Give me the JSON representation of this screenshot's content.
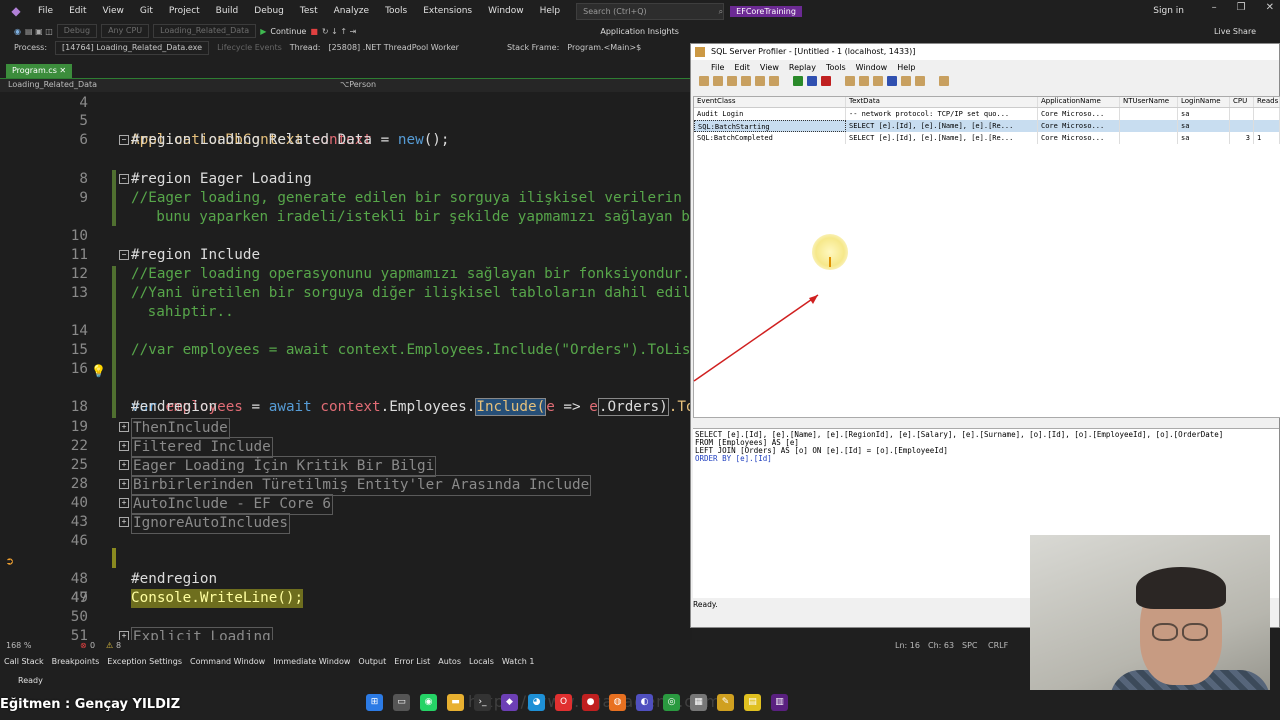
{
  "vs": {
    "menu": [
      "File",
      "Edit",
      "View",
      "Git",
      "Project",
      "Build",
      "Debug",
      "Test",
      "Analyze",
      "Tools",
      "Extensions",
      "Window",
      "Help"
    ],
    "search_placeholder": "Search (Ctrl+Q)",
    "solution_name": "EFCoreTraining",
    "signin": "Sign in",
    "toolbar_debug_config": "Debug",
    "toolbar_platform": "Any CPU",
    "toolbar_project": "Loading_Related_Data",
    "continue_label": "Continue",
    "app_insights": "Application Insights",
    "live_share": "Live Share",
    "process_label": "Process:",
    "process_value": "[14764] Loading_Related_Data.exe",
    "lifecycle_label": "Lifecycle Events",
    "thread_label": "Thread:",
    "thread_value": "[25808] .NET ThreadPool Worker",
    "stackframe_label": "Stack Frame:",
    "stackframe_value": "Program.<Main>$",
    "tab_file": "Program.cs",
    "nav_project": "Loading_Related_Data",
    "nav_type": "Person",
    "zoom": "168 %",
    "errors": "0",
    "warnings": "8",
    "cursor_ln": "Ln: 16",
    "cursor_ch": "Ch: 63",
    "spc": "SPC",
    "crlf": "CRLF",
    "bottom_tabs": [
      "Call Stack",
      "Breakpoints",
      "Exception Settings",
      "Command Window",
      "Immediate Window",
      "Output",
      "Error List",
      "Autos",
      "Locals",
      "Watch 1"
    ],
    "status_ready": "Ready"
  },
  "code": {
    "l4": "4",
    "l5n": "5",
    "l5": [
      "ApplicationDbContext",
      " ",
      "context",
      " = ",
      "new",
      "();"
    ],
    "l6n": "6",
    "l6": "#region Loading Related Data",
    "l8n": "8",
    "l8": "#region Eager Loading",
    "l9n": "9",
    "l9a": "//Eager loading, generate edilen bir sorguya ilişkisel verilerin p",
    "l9b": "  bunu yaparken iradeli/istekli bir şekilde yapmamızı sağlayan bi",
    "l10n": "10",
    "l11n": "11",
    "l11": "#region Include",
    "l12n": "12",
    "l12": "//Eager loading operasyonunu yapmamızı sağlayan bir fonksiyondur.",
    "l13n": "13",
    "l13a": "//Yani üretilen bir sorguya diğer ilişkisel tabloların dahil edilm",
    "l13b": " sahiptir..",
    "l15n": "15",
    "l15": "//var employees = await context.Employees.Include(\"Orders\").ToList",
    "l16n": "16",
    "l16": [
      "var",
      " ",
      "employees",
      " = ",
      "await",
      " ",
      "context",
      ".Employees.",
      "Include(",
      "e",
      " => ",
      "e",
      ".Orders)",
      ".To"
    ],
    "l18n": "18",
    "l18": "#endregion",
    "collapsed": [
      {
        "n": "19",
        "t": "ThenInclude"
      },
      {
        "n": "22",
        "t": "Filtered Include"
      },
      {
        "n": "25",
        "t": "Eager Loading İçin Kritik Bir Bilgi"
      },
      {
        "n": "28",
        "t": "Birbirlerinden Türetilmiş Entity'ler Arasında Include"
      },
      {
        "n": "40",
        "t": "AutoInclude - EF Core 6"
      },
      {
        "n": "43",
        "t": "IgnoreAutoIncludes"
      }
    ],
    "l46n": "46",
    "l47n": "47",
    "l47": "Console.WriteLine();",
    "l48n": "48",
    "l48": "#endregion",
    "l49n": "49",
    "l50n": "50",
    "l51n": "51",
    "l51": "Explicit Loading"
  },
  "profiler": {
    "title": "SQL Server Profiler - [Untitled - 1 (localhost, 1433)]",
    "menu": [
      "File",
      "Edit",
      "View",
      "Replay",
      "Tools",
      "Window",
      "Help"
    ],
    "columns": [
      "EventClass",
      "TextData",
      "ApplicationName",
      "NTUserName",
      "LoginName",
      "CPU",
      "Reads"
    ],
    "rows": [
      [
        "Audit Login",
        "-- network protocol: TCP/IP  set quo...",
        "Core Microso...",
        "",
        "sa",
        "",
        ""
      ],
      [
        "SQL:BatchStarting",
        "SELECT [e].[Id], [e].[Name], [e].[Re...",
        "Core Microso...",
        "",
        "sa",
        "",
        ""
      ],
      [
        "SQL:BatchCompleted",
        "SELECT [e].[Id], [e].[Name], [e].[Re...",
        "Core Microso...",
        "",
        "sa",
        "3",
        "1"
      ]
    ],
    "sql_l1": "SELECT [e].[Id], [e].[Name], [e].[RegionId], [e].[Salary], [e].[Surname], [o].[Id], [o].[EmployeeId], [o].[OrderDate]",
    "sql_l2": "FROM [Employees] AS [e]",
    "sql_l3": "LEFT JOIN [Orders] AS [o] ON [e].[Id] = [o].[EmployeeId]",
    "sql_l4": "ORDER BY [e].[Id]",
    "status": "Ready."
  },
  "overlay": {
    "instructor": "Eğitmen : Gençay YILDIZ",
    "watermark": "https://www.ngakademi.com"
  }
}
